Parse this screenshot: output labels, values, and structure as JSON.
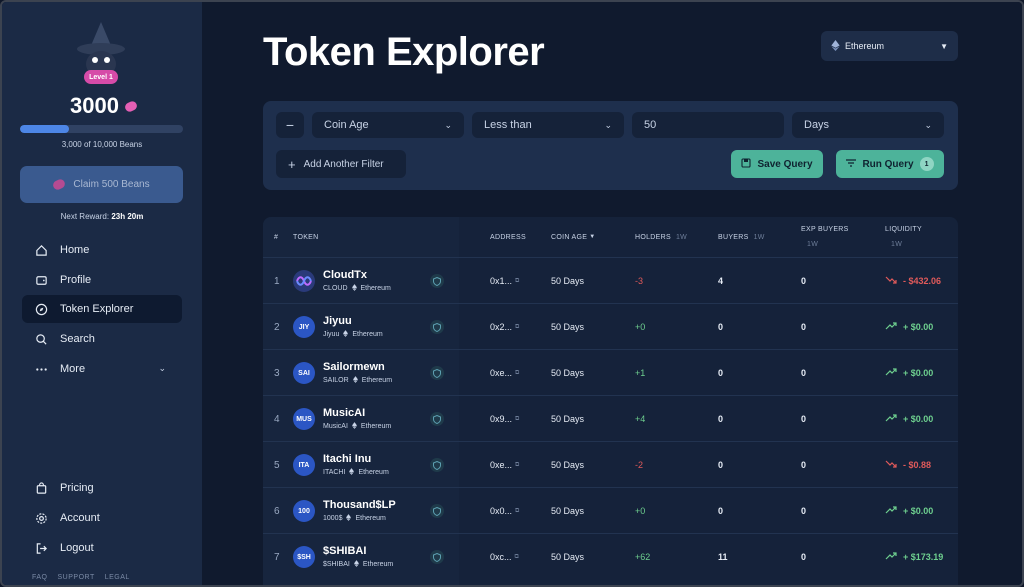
{
  "sidebar": {
    "level_label": "Level 1",
    "beans_count": "3000",
    "beans_progress": 0.3,
    "beans_progress_text": "3,000 of 10,000 Beans",
    "claim_label": "Claim 500 Beans",
    "next_reward_label": "Next Reward:",
    "next_reward_time": "23h 20m",
    "nav": [
      {
        "label": "Home",
        "icon": "home-icon"
      },
      {
        "label": "Profile",
        "icon": "wallet-icon"
      },
      {
        "label": "Token Explorer",
        "icon": "compass-icon"
      },
      {
        "label": "Search",
        "icon": "search-icon"
      },
      {
        "label": "More",
        "icon": "ellipsis-icon"
      }
    ],
    "bottom_nav": [
      {
        "label": "Pricing",
        "icon": "shopping-bag-icon"
      },
      {
        "label": "Account",
        "icon": "gear-icon"
      },
      {
        "label": "Logout",
        "icon": "logout-icon"
      }
    ],
    "footer": [
      "FAQ",
      "SUPPORT",
      "LEGAL"
    ]
  },
  "header": {
    "title": "Token Explorer",
    "chain": "Ethereum"
  },
  "filters": {
    "field": "Coin Age",
    "operator": "Less than",
    "value": "50",
    "unit": "Days",
    "add_label": "Add Another Filter",
    "save_label": "Save Query",
    "run_label": "Run Query",
    "run_count": "1"
  },
  "table": {
    "headers": {
      "num": "#",
      "token": "TOKEN",
      "address": "ADDRESS",
      "coin_age": "COIN AGE",
      "holders": "HOLDERS",
      "buyers": "BUYERS",
      "exp_buyers": "EXP BUYERS",
      "liquidity": "LIQUIDITY",
      "period": "1W"
    },
    "rows": [
      {
        "num": "1",
        "name": "CloudTx",
        "symbol": "CLOUD",
        "chain": "Ethereum",
        "avatar": "",
        "address": "0x1...",
        "age": "50 Days",
        "holders": "-3",
        "buyers": "4",
        "exp_buyers": "0",
        "liquidity": "- $432.06",
        "trend": "down"
      },
      {
        "num": "2",
        "name": "Jiyuu",
        "symbol": "Jiyuu",
        "chain": "Ethereum",
        "avatar": "JIY",
        "address": "0x2...",
        "age": "50 Days",
        "holders": "+0",
        "buyers": "0",
        "exp_buyers": "0",
        "liquidity": "+ $0.00",
        "trend": "up"
      },
      {
        "num": "3",
        "name": "Sailormewn",
        "symbol": "SAILOR",
        "chain": "Ethereum",
        "avatar": "SAI",
        "address": "0xe...",
        "age": "50 Days",
        "holders": "+1",
        "buyers": "0",
        "exp_buyers": "0",
        "liquidity": "+ $0.00",
        "trend": "up"
      },
      {
        "num": "4",
        "name": "MusicAI",
        "symbol": "MusicAI",
        "chain": "Ethereum",
        "avatar": "MUS",
        "address": "0x9...",
        "age": "50 Days",
        "holders": "+4",
        "buyers": "0",
        "exp_buyers": "0",
        "liquidity": "+ $0.00",
        "trend": "up"
      },
      {
        "num": "5",
        "name": "Itachi Inu",
        "symbol": "ITACHI",
        "chain": "Ethereum",
        "avatar": "ITA",
        "address": "0xe...",
        "age": "50 Days",
        "holders": "-2",
        "buyers": "0",
        "exp_buyers": "0",
        "liquidity": "- $0.88",
        "trend": "down"
      },
      {
        "num": "6",
        "name": "Thousand$LP",
        "symbol": "1000$",
        "chain": "Ethereum",
        "avatar": "100",
        "address": "0x0...",
        "age": "50 Days",
        "holders": "+0",
        "buyers": "0",
        "exp_buyers": "0",
        "liquidity": "+ $0.00",
        "trend": "up"
      },
      {
        "num": "7",
        "name": "$SHIBAI",
        "symbol": "$SHIBAI",
        "chain": "Ethereum",
        "avatar": "$SH",
        "address": "0xc...",
        "age": "50 Days",
        "holders": "+62",
        "buyers": "11",
        "exp_buyers": "0",
        "liquidity": "+ $173.19",
        "trend": "up"
      }
    ]
  },
  "colors": {
    "accent": "#4db39a",
    "positive": "#6ed08f",
    "negative": "#e05a5a",
    "sidebar": "#1b2a45",
    "bean": "#e45fb4"
  }
}
